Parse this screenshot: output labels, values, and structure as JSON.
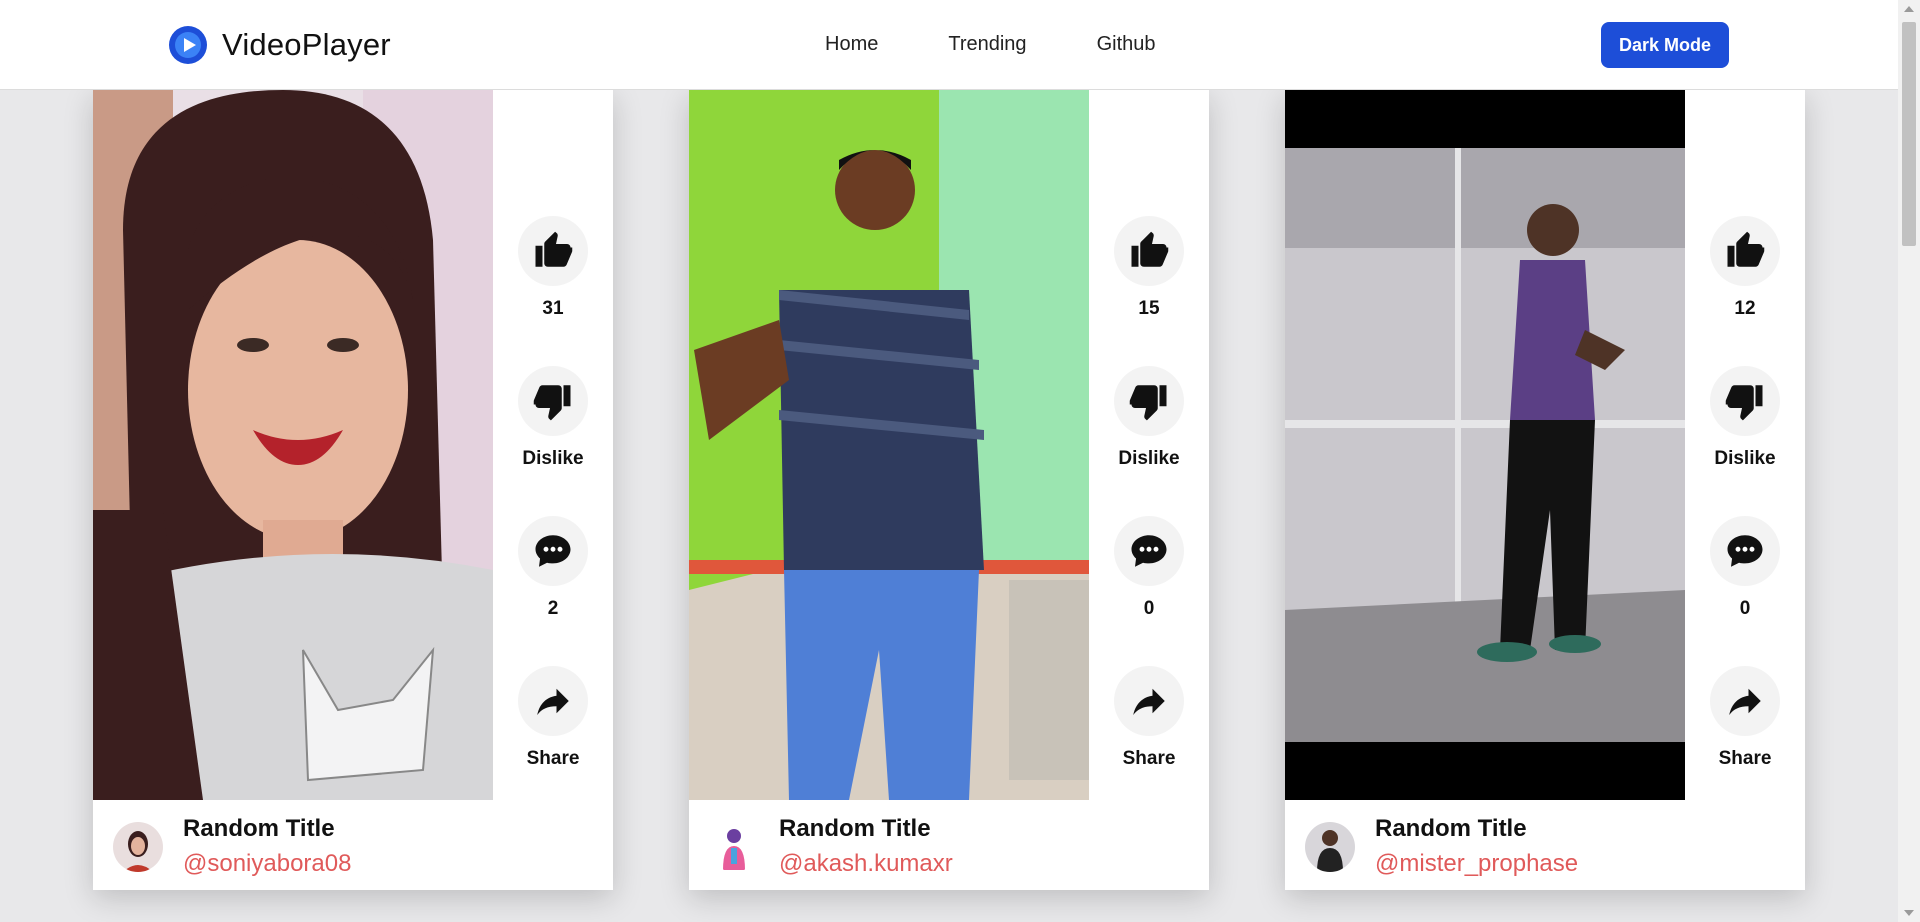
{
  "app": {
    "name": "VideoPlayer"
  },
  "nav": {
    "links": [
      "Home",
      "Trending",
      "Github"
    ],
    "dark_mode_label": "Dark Mode"
  },
  "colors": {
    "accent": "#1d4ed8",
    "handle": "#e05a5a",
    "background": "#e8e8ea",
    "logo": "#1d4ed8"
  },
  "actions": {
    "dislike_label": "Dislike",
    "share_label": "Share"
  },
  "videos": [
    {
      "title": "Random Title",
      "handle": "@soniyabora08",
      "likes": "31",
      "comments": "2"
    },
    {
      "title": "Random Title",
      "handle": "@akash.kumaxr",
      "likes": "15",
      "comments": "0"
    },
    {
      "title": "Random Title",
      "handle": "@mister_prophase",
      "likes": "12",
      "comments": "0"
    }
  ],
  "icons": {
    "like": "thumbs-up-icon",
    "dislike": "thumbs-down-icon",
    "comment": "comment-icon",
    "share": "share-icon"
  }
}
